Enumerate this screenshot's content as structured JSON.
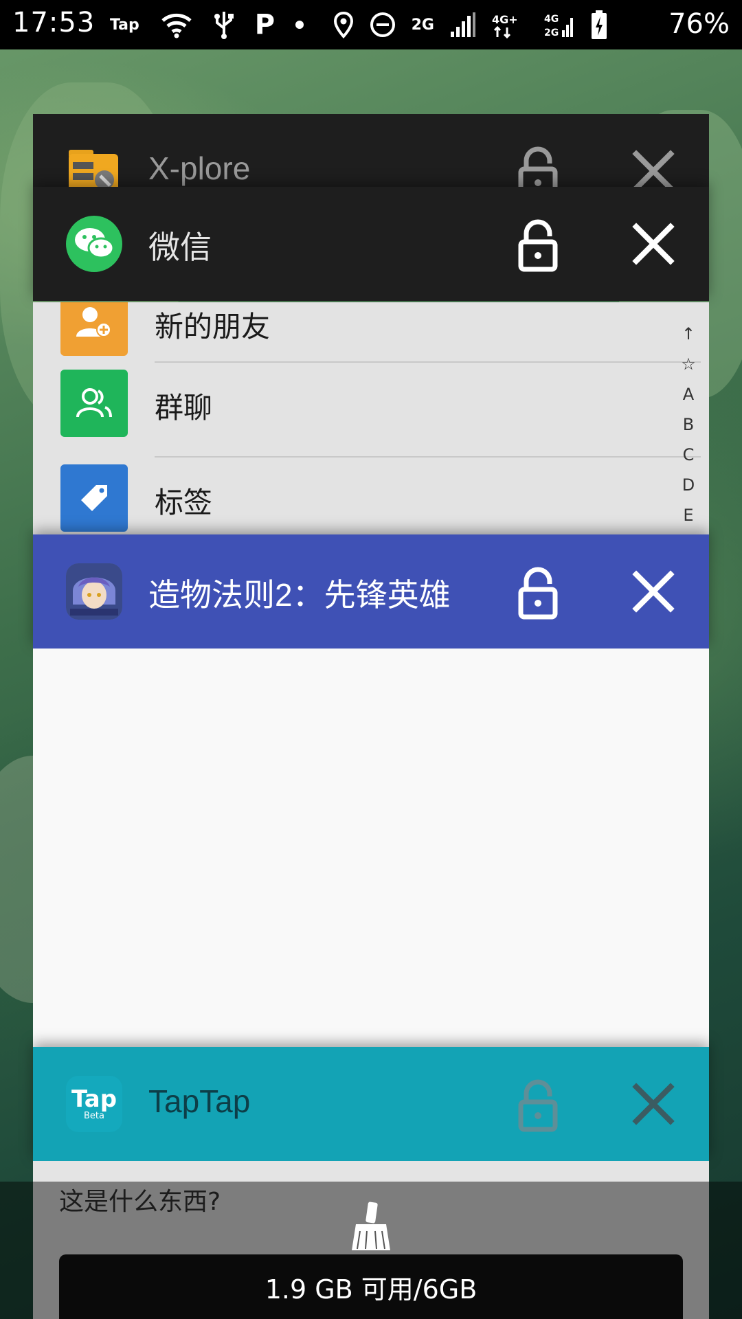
{
  "status_bar": {
    "time": "17:53",
    "tap_label": "Tap",
    "network_label": "2G",
    "battery_percent": "76%"
  },
  "recent_apps": [
    {
      "title": "X-plore",
      "header_color": "#1e1e1e"
    },
    {
      "title": "微信",
      "header_color": "#1e1e1e",
      "contacts": [
        "新的朋友",
        "群聊",
        "标签"
      ],
      "index_letters": [
        "↑",
        "☆",
        "A",
        "B",
        "C",
        "D",
        "E"
      ]
    },
    {
      "title": "造物法则2：先锋英雄",
      "header_color": "#3f51b5"
    },
    {
      "title": "TapTap",
      "header_color": "#13a3b5",
      "icon_text": "Tap",
      "icon_subtext": "Beta",
      "preview_text": "这是什么东西?"
    }
  ],
  "memory": {
    "label": "1.9 GB 可用/6GB"
  },
  "icons": [
    "wifi-icon",
    "usb-icon",
    "location-icon",
    "dnd-icon",
    "signal-icon",
    "battery-icon",
    "lock-icon",
    "close-icon",
    "broom-icon"
  ]
}
